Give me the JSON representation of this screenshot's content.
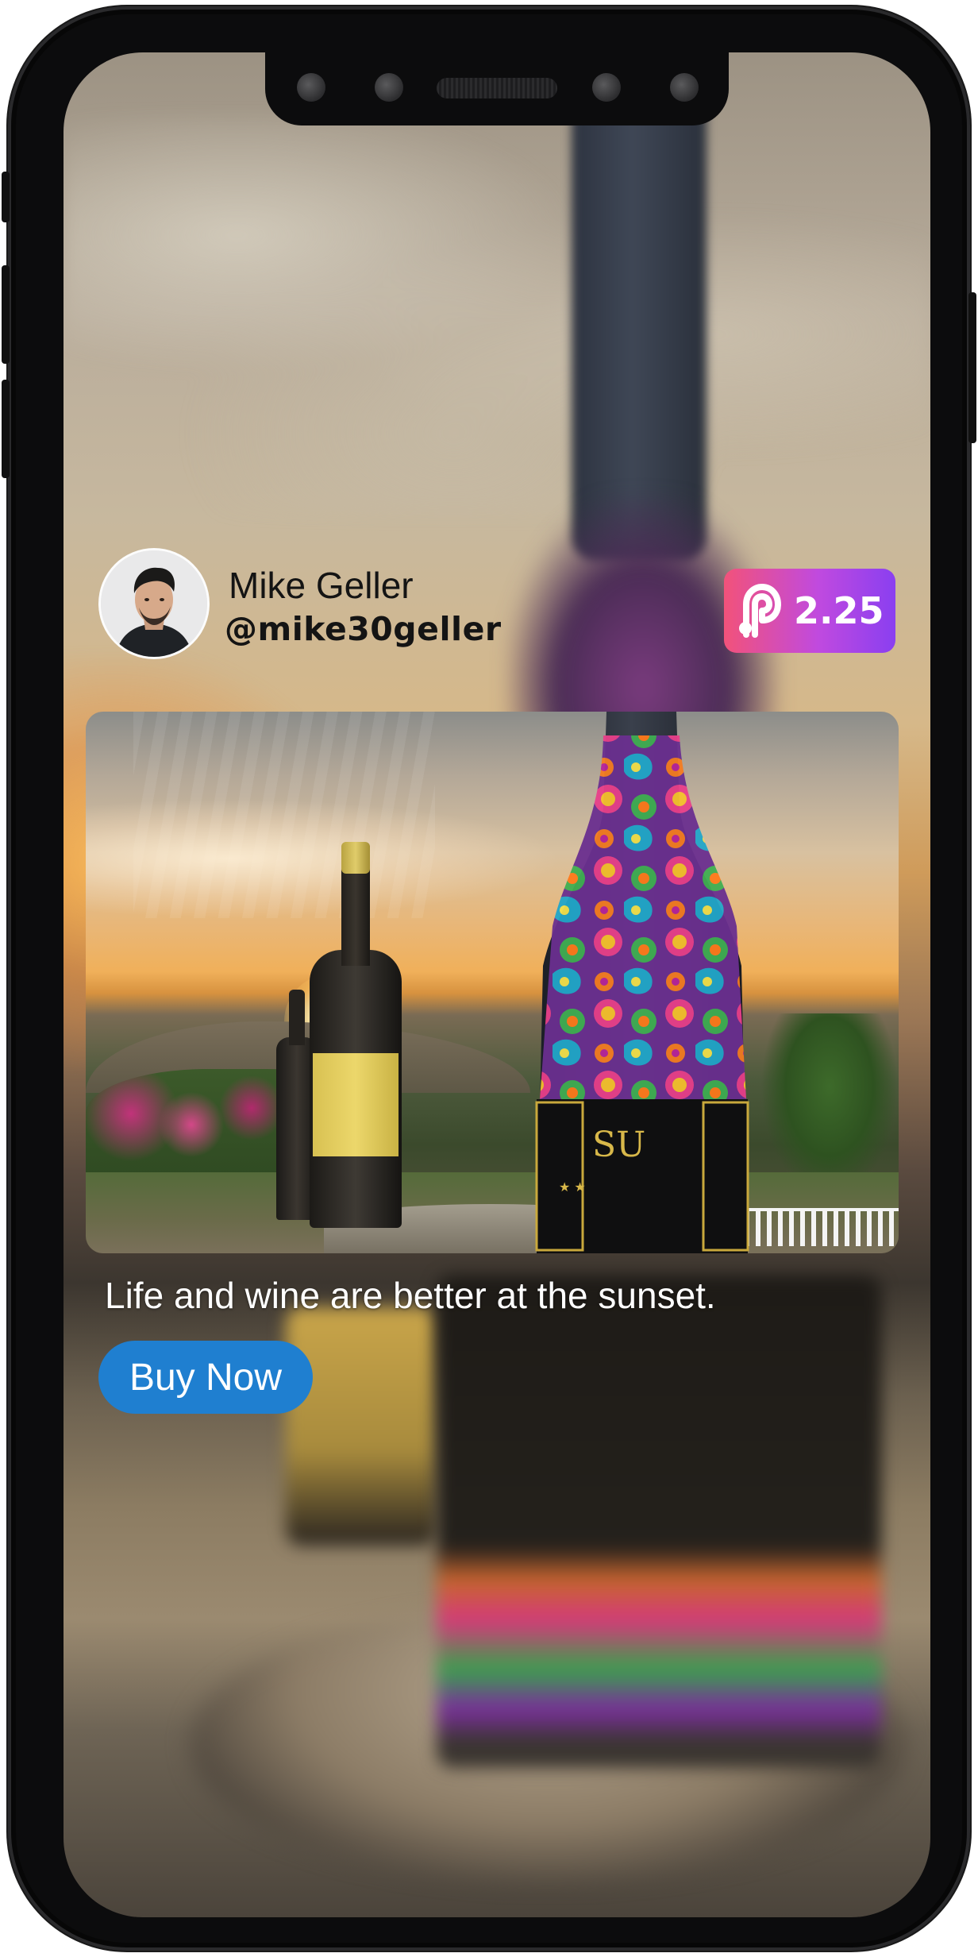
{
  "post": {
    "author": {
      "name": "Mike Geller",
      "handle": "@mike30geller"
    },
    "price_badge": {
      "icon": "audius-logo-icon",
      "value": "2.25"
    },
    "caption": "Life and wine are better at the sunset.",
    "cta_label": "Buy Now"
  },
  "colors": {
    "badge_gradient": [
      "#f2527a",
      "#c04adf",
      "#8a3ff0"
    ],
    "button": "#1f7fd0",
    "text_dark": "#141414",
    "text_light": "#ffffff"
  }
}
